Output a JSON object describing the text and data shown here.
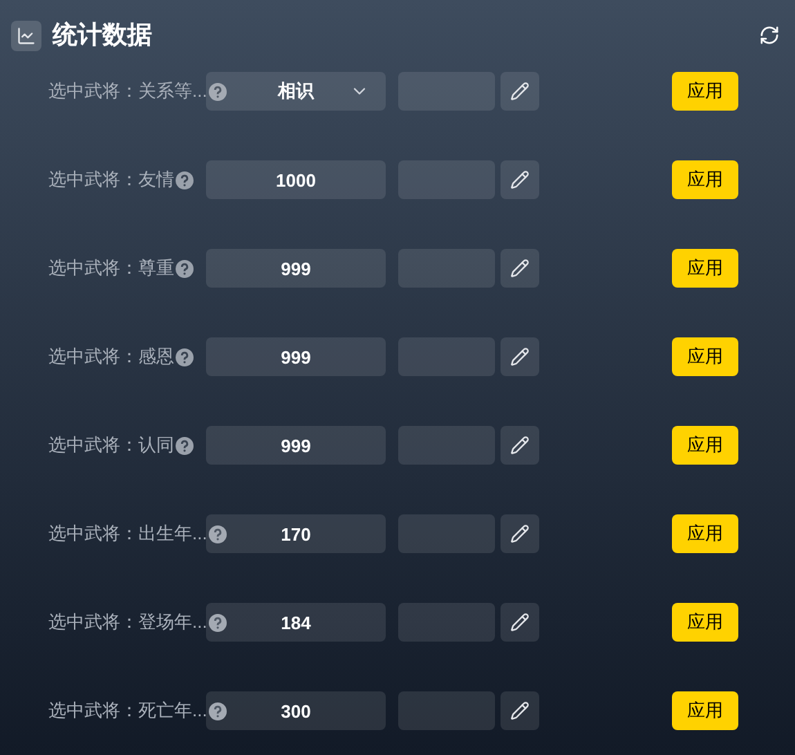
{
  "header": {
    "title": "统计数据"
  },
  "rows": [
    {
      "kind": "select",
      "label": "选中武将：关系等...",
      "value": "相识",
      "apply": "应用"
    },
    {
      "kind": "input",
      "label": "选中武将：友情",
      "value": "1000",
      "apply": "应用"
    },
    {
      "kind": "input",
      "label": "选中武将：尊重",
      "value": "999",
      "apply": "应用"
    },
    {
      "kind": "input",
      "label": "选中武将：感恩",
      "value": "999",
      "apply": "应用"
    },
    {
      "kind": "input",
      "label": "选中武将：认同",
      "value": "999",
      "apply": "应用"
    },
    {
      "kind": "input",
      "label": "选中武将：出生年...",
      "value": "170",
      "apply": "应用"
    },
    {
      "kind": "input",
      "label": "选中武将：登场年...",
      "value": "184",
      "apply": "应用"
    },
    {
      "kind": "input",
      "label": "选中武将：死亡年...",
      "value": "300",
      "apply": "应用"
    }
  ]
}
